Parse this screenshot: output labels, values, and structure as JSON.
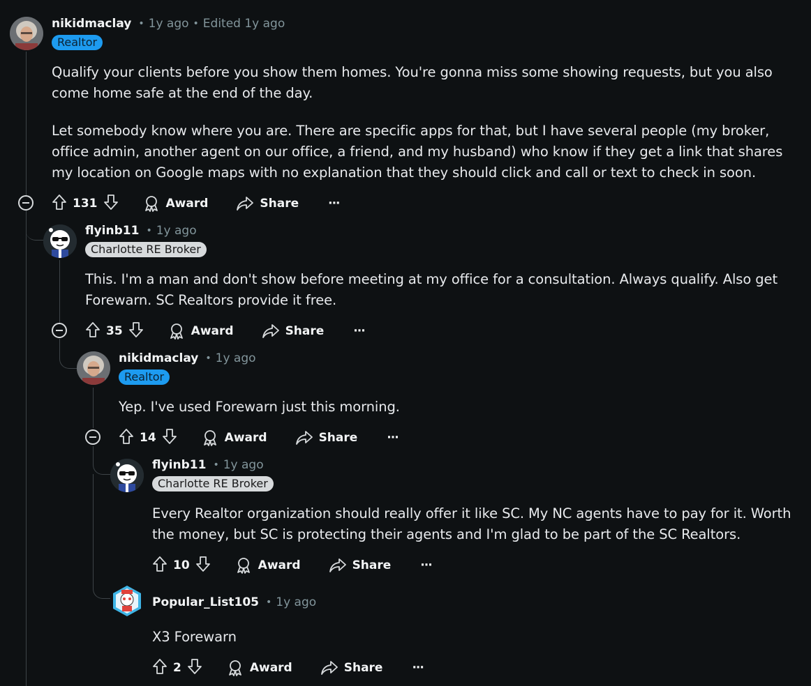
{
  "comments": [
    {
      "username": "nikidmaclay",
      "time": "1y ago",
      "edited": "Edited 1y ago",
      "flair": "Realtor",
      "paragraphs": [
        "Qualify your clients before you show them homes. You're gonna miss some showing requests, but you also come home safe at the end of the day.",
        "Let somebody know where you are. There are specific apps for that, but I have several people (my broker, office admin, another agent on our office, a friend, and my husband) who know if they get a link that shares my location on Google maps with no explanation that they should click and call or text to check in soon."
      ],
      "votes": "131"
    },
    {
      "username": "flyinb11",
      "time": "1y ago",
      "flair": "Charlotte RE Broker",
      "paragraphs": [
        "This. I'm a man and don't show before meeting at my office for a consultation. Always qualify. Also get Forewarn. SC Realtors provide it free."
      ],
      "votes": "35"
    },
    {
      "username": "nikidmaclay",
      "time": "1y ago",
      "flair": "Realtor",
      "paragraphs": [
        "Yep. I've used Forewarn just this morning."
      ],
      "votes": "14"
    },
    {
      "username": "flyinb11",
      "time": "1y ago",
      "flair": "Charlotte RE Broker",
      "paragraphs": [
        "Every Realtor organization should really offer it like SC. My NC agents have to pay for it. Worth the money, but SC is protecting their agents and I'm glad to be part of the SC Realtors."
      ],
      "votes": "10"
    },
    {
      "username": "Popular_List105",
      "time": "1y ago",
      "flair": "",
      "paragraphs": [
        "X3 Forewarn"
      ],
      "votes": "2"
    }
  ],
  "labels": {
    "award": "Award",
    "share": "Share",
    "more": "···",
    "separator": "•"
  },
  "icons": [
    "upvote-icon",
    "downvote-icon",
    "award-icon",
    "share-icon",
    "collapse-icon",
    "more-icon"
  ],
  "colors": {
    "background": "#0e1113",
    "flair_realtor": "#1d9bf0",
    "flair_broker": "#d7dadc",
    "thread_line": "#3e4448"
  }
}
